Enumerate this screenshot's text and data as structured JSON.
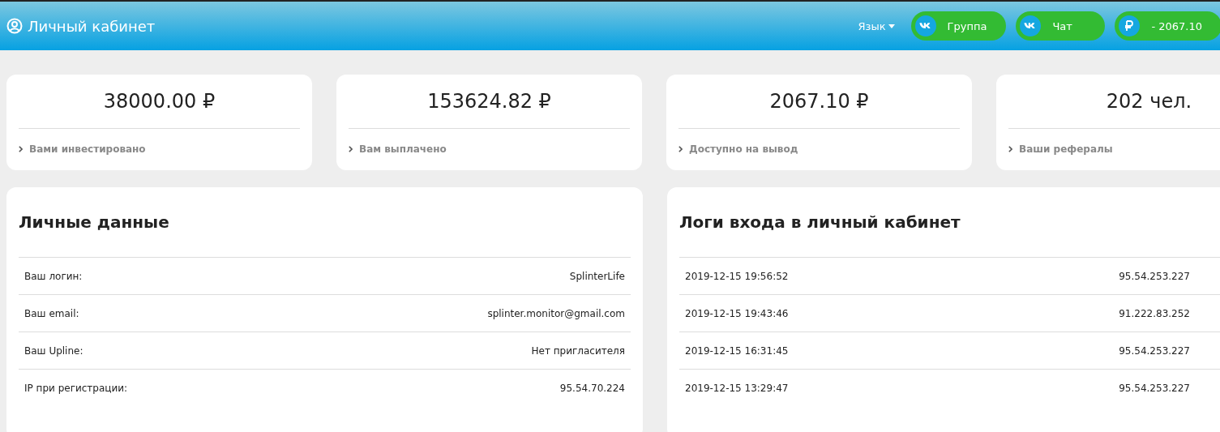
{
  "header": {
    "title": "Личный кабинет",
    "language": "Язык",
    "buttons": [
      {
        "kind": "vk",
        "label": "Группа"
      },
      {
        "kind": "vk",
        "label": "Чат"
      },
      {
        "kind": "ruble",
        "label": "- 2067.10"
      }
    ]
  },
  "stats": [
    {
      "value": "38000.00 ₽",
      "label": "Вами инвестировано"
    },
    {
      "value": "153624.82 ₽",
      "label": "Вам выплачено"
    },
    {
      "value": "2067.10 ₽",
      "label": "Доступно на вывод"
    },
    {
      "value": "202 чел.",
      "label": "Ваши рефералы"
    }
  ],
  "panels": [
    {
      "title": "Личные данные",
      "rows": [
        [
          "Ваш логин:",
          "SplinterLife"
        ],
        [
          "Ваш email:",
          "splinter.monitor@gmail.com"
        ],
        [
          "Ваш Upline:",
          "Нет пригласителя"
        ],
        [
          "IP при регистрации:",
          "95.54.70.224"
        ]
      ]
    },
    {
      "title": "Логи входа в личный кабинет",
      "rows": [
        [
          "2019-12-15 19:56:52",
          "95.54.253.227"
        ],
        [
          "2019-12-15 19:43:46",
          "91.222.83.252"
        ],
        [
          "2019-12-15 16:31:45",
          "95.54.253.227"
        ],
        [
          "2019-12-15 13:29:47",
          "95.54.253.227"
        ]
      ]
    }
  ]
}
